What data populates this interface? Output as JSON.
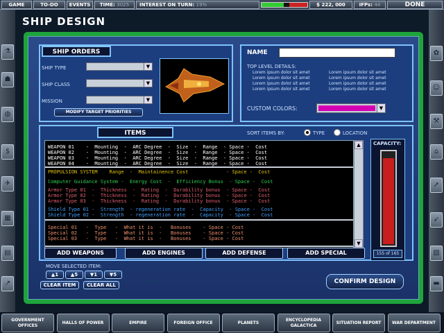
{
  "topbar": {
    "game_menu": "GAME MENU",
    "todo": "TO-DO LIST",
    "events": "EVENTS",
    "time_label": "TIME:",
    "time_value": "3025",
    "interest_label": "INTEREST ON TURN:",
    "interest_value": "19%",
    "interest_fraction": 0.19,
    "money": "$ 222, 000",
    "ifps_label": "IFPs:",
    "ifps_value": "44",
    "done": "DONE"
  },
  "title": "SHIP DESIGN",
  "ship_orders": {
    "header": "SHIP ORDERS",
    "ship_type": "SHIP TYPE",
    "ship_class": "SHIP CLASS",
    "mission": "MISSION",
    "modify_btn": "MODIFY TARGET PRIORITIES"
  },
  "details": {
    "name_label": "NAME",
    "name_value": "",
    "top_level": "TOP LEVEL DETAILS:",
    "lorem": "Lorem ipsum dolor sit amet",
    "custom_colors": "CUSTOM COLORS:",
    "custom_color_hex": "#d400b4"
  },
  "items": {
    "header": "ITEMS",
    "sort_label": "SORT ITEMS BY:",
    "sort_type": "TYPE",
    "sort_location": "LOCATION",
    "rows": [
      {
        "text": "WEAPON 01    -  Mounting  -  ARC Degree  -  Size  -  Range  - Space -  Cost",
        "color": "#ffffff"
      },
      {
        "text": "WEAPON 02    -  Mounting  -  ARC Degree  -  Size  -  Range  - Space -  Cost",
        "color": "#ffffff"
      },
      {
        "text": "WEAPON 03    -  Mounting  -  ARC Degree  -  Size  -  Range  - Space -  Cost",
        "color": "#ffffff"
      },
      {
        "text": "WEAPON 04    -  Mounting  -  ARC Degree  -  Size  -  Range  - Space -  Cost",
        "color": "#ffffff"
      },
      {
        "text": "PROPULSION SYSTEM    Range  -  Maintainence Cost             - Space -  Cost",
        "color": "#e0c010"
      },
      {
        "text": "Computer Guidance System -  Energy Cost  -  Efficiency Bonus  - Space -  Cost",
        "color": "#30d050"
      },
      {
        "text": "Armor Type 01  -  Thickness  -  Rating  -  Durability bonus  - Space -  Cost",
        "color": "#e06070"
      },
      {
        "text": "Armor Type 02  -  Thickness  -  Rating  -  Durability bonus  - Space -  Cost",
        "color": "#e06070"
      },
      {
        "text": "Armor Type 03  -  Thickness  -  Rating  -  Durability bonus  - Space -  Cost",
        "color": "#e06070"
      },
      {
        "text": "Shield Type 01 -  Strength  - regeneration rate  -  Capacity  - Space -  Cost",
        "color": "#40a0ff"
      },
      {
        "text": "Shield Type 02 -  Strength  - regeneration rate  -  Capacity  - Space -  Cost",
        "color": "#40a0ff"
      },
      {
        "text": "Special 01   -  Type   -  What it is  -   Bonuses    - Space - Cost",
        "color": "#f09070"
      },
      {
        "text": "Special 02   -  Type   -  What it is  -   Bonuses    - Space - Cost",
        "color": "#f09070"
      },
      {
        "text": "Special 03   -  Type   -  What it is  -   Bonuses    - Space - Cost",
        "color": "#f09070"
      }
    ],
    "add_weapons": "ADD WEAPONS",
    "add_engines": "ADD ENGINES",
    "add_defense": "ADD DEFENSE",
    "add_special": "ADD SPECIAL"
  },
  "capacity": {
    "label": "CAPACITY:",
    "value": "155 of 165",
    "fraction": 0.94
  },
  "move": {
    "label": "MOVE SELECTED ITEM:",
    "up1": "1",
    "up5": "5",
    "down1": "1",
    "down5": "5",
    "clear_item": "CLEAR ITEM",
    "clear_all": "CLEAR ALL"
  },
  "confirm": "CONFIRM DESIGN",
  "bottom_tabs": [
    "GOVERNMENT OFFICES",
    "HALLS OF POWER",
    "EMPIRE",
    "FOREIGN OFFICE",
    "PLANETS",
    "ENCYCLOPEDIA GALACTICA",
    "SITUATION REPORT",
    "WAR DEPARTMENT"
  ]
}
